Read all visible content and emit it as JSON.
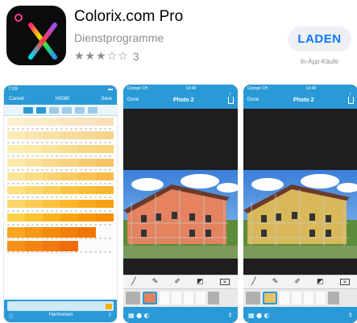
{
  "app": {
    "title": "Colorix.com Pro",
    "category": "Dienstprogramme",
    "rating_count": "3",
    "rating_stars": 3,
    "stars_glyphs": "★★★☆☆",
    "get_label": "LADEN",
    "in_app_note": "In-App-Käufe",
    "icon_letter": "X"
  },
  "colors": {
    "accent": "#0a7aff",
    "toolbar_blue": "#2a9ad7",
    "house_orange": "#e5825f",
    "house_yellow": "#d9b85a"
  },
  "screens": [
    {
      "id": "color-list",
      "status_time": "7:09",
      "nav_left": "Cancel",
      "nav_center": "H0080",
      "nav_right": "Save",
      "bottom_center": "Harmonien"
    },
    {
      "id": "photo-edit-orange",
      "status_left": "Orange CH",
      "status_time": "14:48",
      "nav_left": "Done",
      "nav_title": "Photo 2"
    },
    {
      "id": "photo-edit-yellow",
      "status_left": "Orange CH",
      "status_time": "14:48",
      "nav_left": "Done",
      "nav_title": "Photo 2"
    }
  ]
}
